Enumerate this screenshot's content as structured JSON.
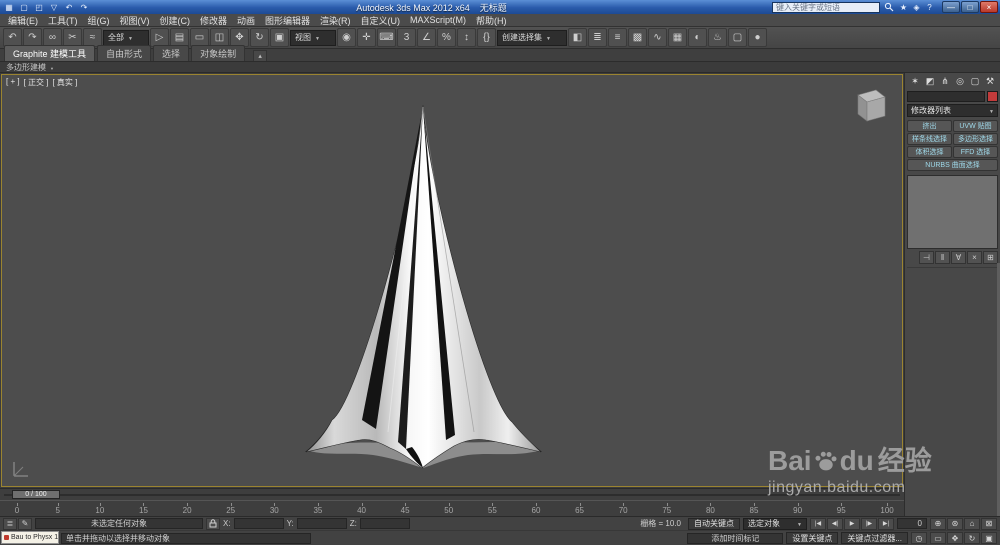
{
  "window": {
    "title": "Autodesk 3ds Max 2012 x64",
    "document": "无标题",
    "search_placeholder": "键入关键字或短语",
    "quick_access": [
      {
        "name": "application-button",
        "glyph": "▦"
      },
      {
        "name": "new-scene-icon",
        "glyph": "▢"
      },
      {
        "name": "open-file-icon",
        "glyph": "◰"
      },
      {
        "name": "save-file-icon",
        "glyph": "▽"
      },
      {
        "name": "undo-quick-icon",
        "glyph": "↶"
      },
      {
        "name": "redo-quick-icon",
        "glyph": "↷"
      }
    ],
    "infocenter_icons": [
      {
        "name": "favorites-icon",
        "glyph": "★"
      },
      {
        "name": "communication-center-icon",
        "glyph": "◈"
      },
      {
        "name": "help-icon",
        "glyph": "?"
      }
    ],
    "controls": [
      {
        "name": "minimize-button",
        "glyph": "—"
      },
      {
        "name": "maximize-button",
        "glyph": "□"
      },
      {
        "name": "close-button",
        "glyph": "×"
      }
    ]
  },
  "menubar": {
    "items": [
      "编辑(E)",
      "工具(T)",
      "组(G)",
      "视图(V)",
      "创建(C)",
      "修改器",
      "动画",
      "图形编辑器",
      "渲染(R)",
      "自定义(U)",
      "MAXScript(M)",
      "帮助(H)"
    ]
  },
  "toolbar": {
    "left_icons": [
      {
        "name": "undo-icon",
        "glyph": "↶"
      },
      {
        "name": "redo-icon",
        "glyph": "↷"
      },
      {
        "name": "select-and-link-icon",
        "glyph": "∞"
      },
      {
        "name": "unlink-selection-icon",
        "glyph": "✂"
      },
      {
        "name": "bind-to-space-warp-icon",
        "glyph": "≈"
      }
    ],
    "selection_filter_value": "全部",
    "select_icons": [
      {
        "name": "select-object-icon",
        "glyph": "▷"
      },
      {
        "name": "select-by-name-icon",
        "glyph": "▤"
      },
      {
        "name": "selection-region-icon",
        "glyph": "▭"
      },
      {
        "name": "window-crossing-icon",
        "glyph": "◫"
      },
      {
        "name": "select-and-move-icon",
        "glyph": "✥"
      },
      {
        "name": "select-and-rotate-icon",
        "glyph": "↻"
      },
      {
        "name": "select-and-scale-icon",
        "glyph": "▣"
      }
    ],
    "coord_system_value": "视图",
    "mid_icons": [
      {
        "name": "use-pivot-center-icon",
        "glyph": "◉"
      },
      {
        "name": "select-and-manipulate-icon",
        "glyph": "✛"
      },
      {
        "name": "keyboard-override-icon",
        "glyph": "⌨"
      },
      {
        "name": "snaps-toggle-icon",
        "glyph": "3"
      },
      {
        "name": "angle-snap-icon",
        "glyph": "∠"
      },
      {
        "name": "percent-snap-icon",
        "glyph": "%"
      },
      {
        "name": "spinner-snap-icon",
        "glyph": "↕"
      },
      {
        "name": "edit-named-sets-icon",
        "glyph": "{}"
      }
    ],
    "named_sets_value": "创建选择集",
    "right_icons": [
      {
        "name": "mirror-icon",
        "glyph": "◧"
      },
      {
        "name": "align-icon",
        "glyph": "≣"
      },
      {
        "name": "layer-manager-icon",
        "glyph": "≡"
      },
      {
        "name": "graphite-toggle-icon",
        "glyph": "▩"
      },
      {
        "name": "curve-editor-icon",
        "glyph": "∿"
      },
      {
        "name": "schematic-view-icon",
        "glyph": "▦"
      },
      {
        "name": "material-editor-icon",
        "glyph": "◐"
      },
      {
        "name": "render-setup-icon",
        "glyph": "♨"
      },
      {
        "name": "rendered-frame-icon",
        "glyph": "▢"
      },
      {
        "name": "render-production-icon",
        "glyph": "●"
      }
    ]
  },
  "ribbon": {
    "tabs": [
      "Graphite 建模工具",
      "自由形式",
      "选择",
      "对象绘制"
    ],
    "collapse_glyph": "▴",
    "panel_title": "多边形建模"
  },
  "viewport": {
    "labels": [
      "[ + ]",
      "[ 正交 ]",
      "[ 真实 ]"
    ]
  },
  "command_panel": {
    "tabs": [
      {
        "name": "create-tab",
        "glyph": "✶"
      },
      {
        "name": "modify-tab",
        "glyph": "◩"
      },
      {
        "name": "hierarchy-tab",
        "glyph": "⋔"
      },
      {
        "name": "motion-tab",
        "glyph": "◎"
      },
      {
        "name": "display-tab",
        "glyph": "▢"
      },
      {
        "name": "utilities-tab",
        "glyph": "⚒"
      }
    ],
    "object_color": "#c23b3b",
    "modifier_list_label": "修改器列表",
    "modifier_buttons": [
      "挤出",
      "UVW 贴图",
      "样条线选择",
      "多边形选择",
      "体积选择",
      "FFD 选择",
      "NURBS 曲面选择"
    ],
    "stack_tools": [
      {
        "name": "pin-stack-button",
        "glyph": "⊣"
      },
      {
        "name": "show-end-result-button",
        "glyph": "‖"
      },
      {
        "name": "make-unique-button",
        "glyph": "∀"
      },
      {
        "name": "remove-modifier-button",
        "glyph": "×"
      },
      {
        "name": "configure-modifier-sets-button",
        "glyph": "⊞"
      }
    ]
  },
  "timeline": {
    "slider_label": "0 / 100",
    "ticks": [
      "0",
      "5",
      "10",
      "15",
      "20",
      "25",
      "30",
      "35",
      "40",
      "45",
      "50",
      "55",
      "60",
      "65",
      "70",
      "75",
      "80",
      "85",
      "90",
      "95",
      "100"
    ]
  },
  "status": {
    "left_icons": [
      {
        "name": "maxscript-mini-listener-icon",
        "glyph": "≣"
      },
      {
        "name": "prompt-history-icon",
        "glyph": "✎"
      }
    ],
    "selection_text": "未选定任何对象",
    "x_label": "X:",
    "y_label": "Y:",
    "z_label": "Z:",
    "grid_text": "栅格 = 10.0",
    "prompt_text": "单击并拖动以选择并移动对象",
    "time_tag_text": "添加时间标记",
    "mini_window_text": "Bau to Physx 1",
    "auto_key": "自动关键点",
    "set_key": "设置关键点",
    "selected_filter": "选定对象",
    "key_filters": "关键点过滤器...",
    "frame_value": "0",
    "time_config_glyph": "◷",
    "playback": [
      {
        "name": "go-to-start-button",
        "glyph": "|◀"
      },
      {
        "name": "previous-frame-button",
        "glyph": "◀|"
      },
      {
        "name": "play-button",
        "glyph": "▶"
      },
      {
        "name": "next-frame-button",
        "glyph": "|▶"
      },
      {
        "name": "go-to-end-button",
        "glyph": "▶|"
      }
    ],
    "nav_row1": [
      {
        "name": "zoom-icon",
        "glyph": "⊕"
      },
      {
        "name": "zoom-all-icon",
        "glyph": "⊛"
      },
      {
        "name": "zoom-extents-icon",
        "glyph": "⌂"
      },
      {
        "name": "zoom-extents-all-icon",
        "glyph": "⊠"
      }
    ],
    "nav_row2": [
      {
        "name": "zoom-region-icon",
        "glyph": "▭"
      },
      {
        "name": "pan-icon",
        "glyph": "✥"
      },
      {
        "name": "orbit-icon",
        "glyph": "↻"
      },
      {
        "name": "maximize-viewport-toggle-icon",
        "glyph": "▣"
      }
    ]
  },
  "watermark": {
    "brand_left": "Bai",
    "brand_right": "du",
    "brand_cn": "经验",
    "url": "jingyan.baidu.com"
  }
}
